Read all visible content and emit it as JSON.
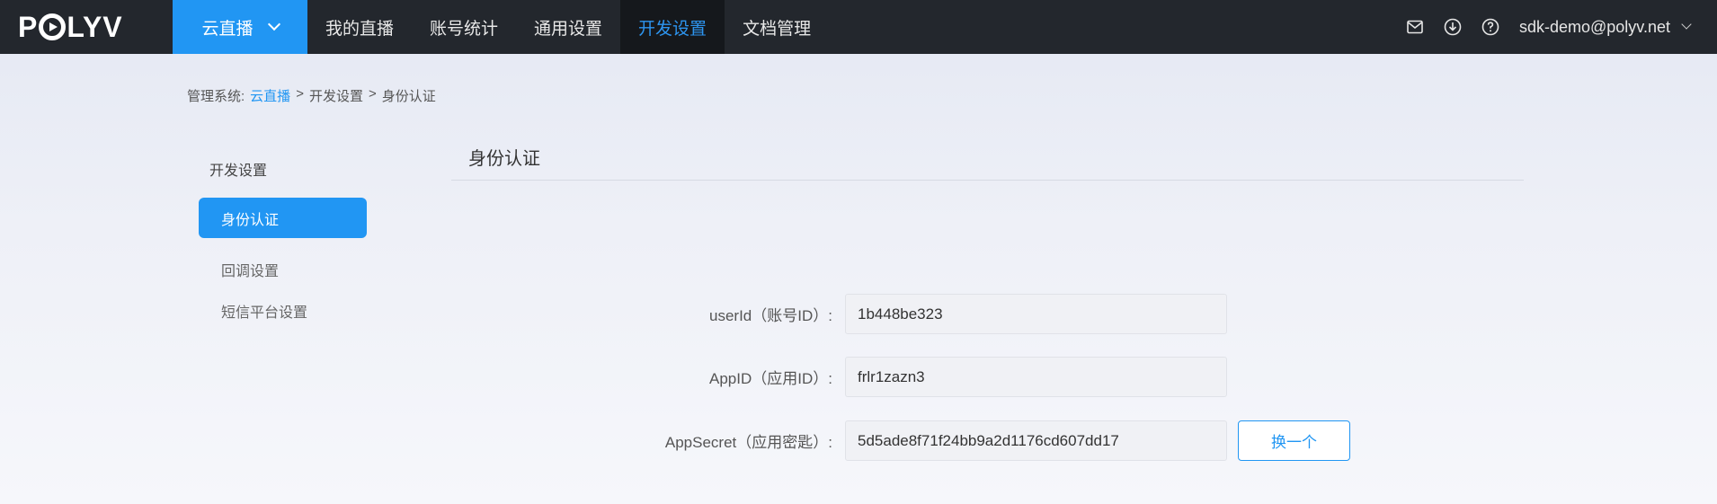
{
  "brand": {
    "logo_text_left": "P",
    "logo_text_right": "LYV"
  },
  "topnav": {
    "product": "云直播",
    "items": [
      "我的直播",
      "账号统计",
      "通用设置",
      "开发设置",
      "文档管理"
    ],
    "active_index": 3,
    "icons": [
      "mail-icon",
      "download-icon",
      "help-icon"
    ],
    "user": "sdk-demo@polyv.net"
  },
  "breadcrumb": {
    "prefix": "管理系统:",
    "root": "云直播",
    "sep1": ">",
    "level1": "开发设置",
    "sep2": ">",
    "level2": "身份认证"
  },
  "sidebar": {
    "title": "开发设置",
    "items": [
      "身份认证",
      "回调设置",
      "短信平台设置"
    ],
    "active_index": 0
  },
  "content": {
    "title": "身份认证",
    "fields": [
      {
        "label": "userId（账号ID）:",
        "value": "1b448be323"
      },
      {
        "label": "AppID（应用ID）:",
        "value": "frlr1zazn3"
      },
      {
        "label": "AppSecret（应用密匙）:",
        "value": "5d5ade8f71f24bb9a2d1176cd607dd17"
      }
    ],
    "change_button": "换一个"
  },
  "colors": {
    "accent": "#2196f3",
    "topbar": "#23272d",
    "active_nav_bg": "#15181c"
  }
}
